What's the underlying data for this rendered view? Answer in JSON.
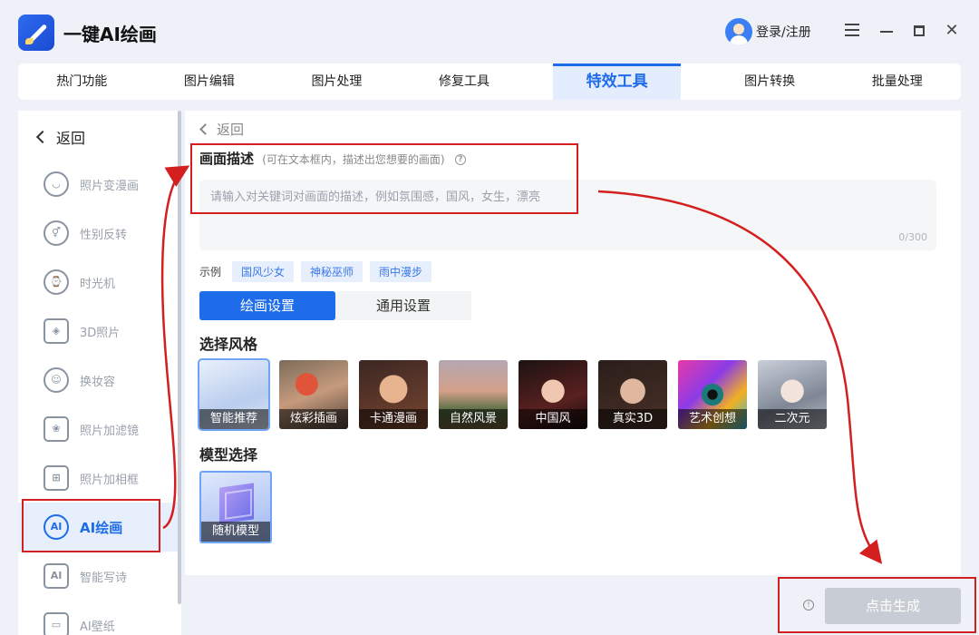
{
  "app": {
    "title": "一键AI绘画",
    "login": "登录/注册"
  },
  "tabs": [
    {
      "label": "热门功能"
    },
    {
      "label": "图片编辑"
    },
    {
      "label": "图片处理"
    },
    {
      "label": "修复工具"
    },
    {
      "label": "特效工具"
    },
    {
      "label": "图片转换"
    },
    {
      "label": "批量处理"
    }
  ],
  "sidebar": {
    "back": "返回",
    "items": [
      {
        "label": "照片变漫画",
        "icon": "face-icon"
      },
      {
        "label": "性别反转",
        "icon": "gender-icon"
      },
      {
        "label": "时光机",
        "icon": "clock-icon"
      },
      {
        "label": "3D照片",
        "icon": "layers-icon"
      },
      {
        "label": "换妆容",
        "icon": "makeup-icon"
      },
      {
        "label": "照片加滤镜",
        "icon": "filter-icon"
      },
      {
        "label": "照片加相框",
        "icon": "frame-icon"
      },
      {
        "label": "AI绘画",
        "icon": "ai-paint-icon"
      },
      {
        "label": "智能写诗",
        "icon": "ai-poem-icon"
      },
      {
        "label": "AI壁纸",
        "icon": "wallpaper-icon"
      }
    ]
  },
  "main": {
    "back": "返回",
    "desc_title": "画面描述",
    "desc_hint": "(可在文本框内，描述出您想要的画面)",
    "placeholder": "请输入对关键词对画面的描述，例如氛围感，国风，女生，漂亮",
    "counter": "0/300",
    "examples_label": "示例",
    "examples": [
      "国风少女",
      "神秘巫师",
      "雨中漫步"
    ],
    "setting_tabs": [
      "绘画设置",
      "通用设置"
    ],
    "style_title": "选择风格",
    "styles": [
      "智能推荐",
      "炫彩插画",
      "卡通漫画",
      "自然风景",
      "中国风",
      "真实3D",
      "艺术创想",
      "二次元"
    ],
    "model_title": "模型选择",
    "model": "随机模型",
    "generate": "点击生成"
  },
  "colors": {
    "accent": "#1e6ce9",
    "annotation": "#d31f1f"
  }
}
